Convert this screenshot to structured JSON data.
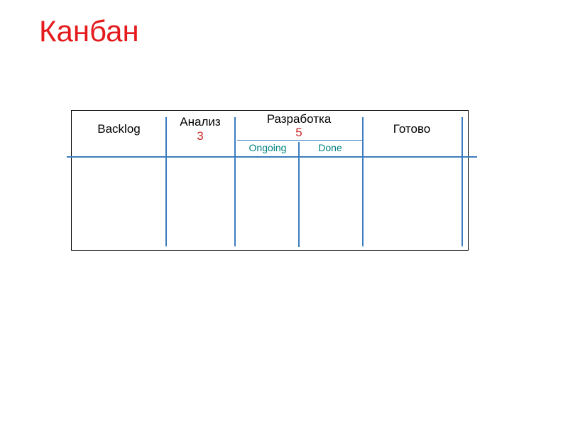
{
  "title": "Канбан",
  "board": {
    "columns": {
      "backlog": {
        "label": "Backlog"
      },
      "analysis": {
        "label": "Анализ",
        "wip_limit": "3"
      },
      "development": {
        "label": "Разработка",
        "wip_limit": "5",
        "sub": {
          "ongoing": "Ongoing",
          "done": "Done"
        }
      },
      "ready": {
        "label": "Готово"
      }
    }
  },
  "colors": {
    "title": "#e41a1c",
    "line": "#3b7dbf",
    "wip": "#c62828",
    "sublabel": "#008080"
  }
}
